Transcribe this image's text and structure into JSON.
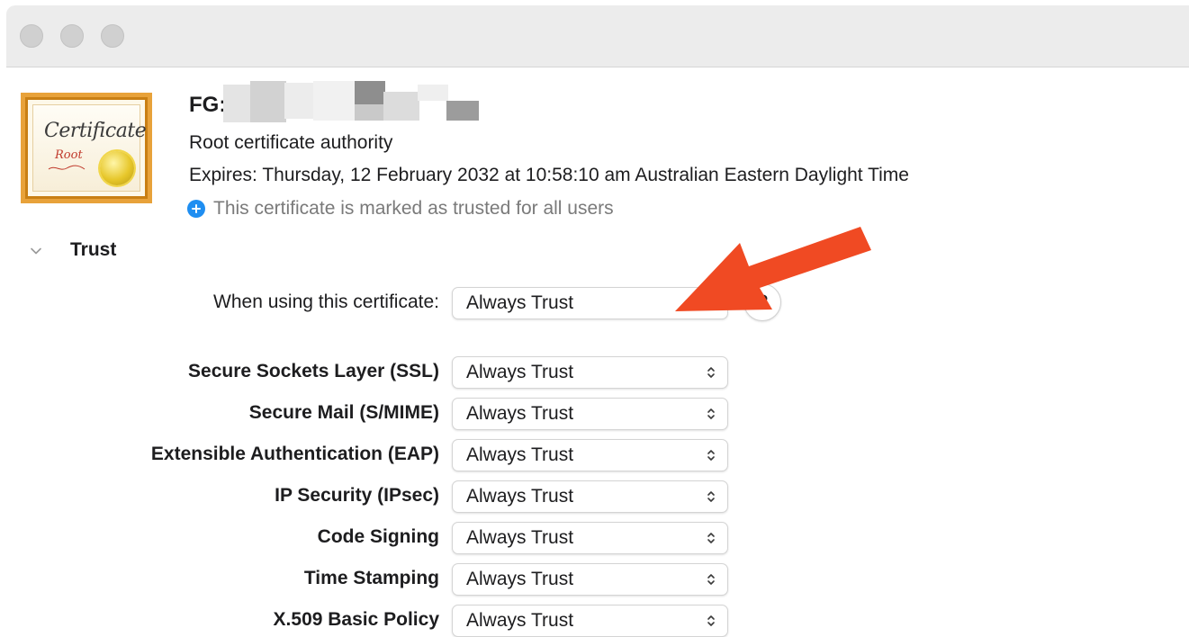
{
  "window": {
    "traffic_lights": [
      "close",
      "minimize",
      "zoom"
    ]
  },
  "certificate": {
    "icon_script_text": "Certificate",
    "icon_root_text": "Root",
    "name_prefix": "FG:",
    "type": "Root certificate authority",
    "expires": "Expires: Thursday, 12 February 2032 at 10:58:10 am Australian Eastern Daylight Time",
    "trust_status": "This certificate is marked as trusted for all users",
    "trust_status_icon": "plus-circle-icon",
    "trust_status_icon_color": "#1f8ef1"
  },
  "trust": {
    "section_title": "Trust",
    "when_using_label": "When using this certificate:",
    "when_using_value": "Always Trust",
    "help_label": "?",
    "policies": [
      {
        "label": "Secure Sockets Layer (SSL)",
        "value": "Always Trust"
      },
      {
        "label": "Secure Mail (S/MIME)",
        "value": "Always Trust"
      },
      {
        "label": "Extensible Authentication (EAP)",
        "value": "Always Trust"
      },
      {
        "label": "IP Security (IPsec)",
        "value": "Always Trust"
      },
      {
        "label": "Code Signing",
        "value": "Always Trust"
      },
      {
        "label": "Time Stamping",
        "value": "Always Trust"
      },
      {
        "label": "X.509 Basic Policy",
        "value": "Always Trust"
      }
    ]
  },
  "annotation": {
    "arrow_color": "#f04a23"
  }
}
